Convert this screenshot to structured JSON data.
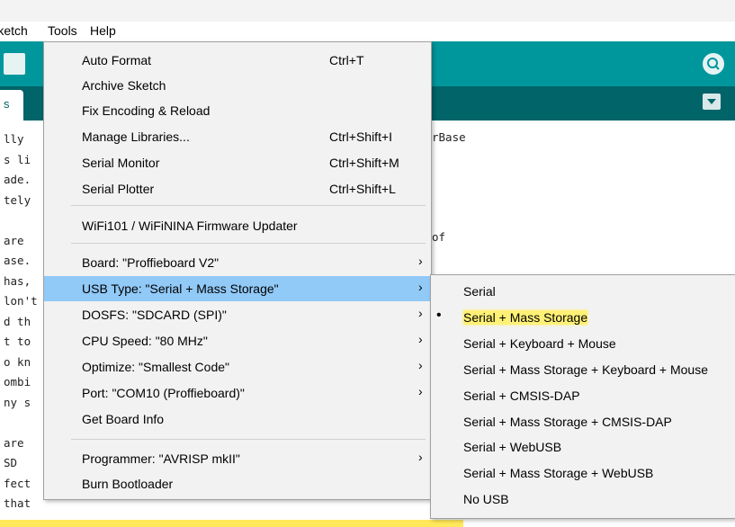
{
  "menubar": {
    "sketch": "Sketch",
    "tools": "Tools",
    "help": "Help"
  },
  "tab": {
    "label": "s"
  },
  "code_left": [
    "lly",
    "s li",
    "ade.",
    "tely",
    "",
    "are",
    "ase.",
    "has,",
    "lon't",
    "d th",
    "t to",
    "o kn",
    "ombi",
    "ny s",
    "",
    "are",
    "SD",
    "fect",
    "that"
  ],
  "code_right": {
    "line1": "rBase",
    "line2": "of"
  },
  "tools_menu": {
    "auto_format": {
      "label": "Auto Format",
      "shortcut": "Ctrl+T"
    },
    "archive_sketch": {
      "label": "Archive Sketch"
    },
    "fix_encoding": {
      "label": "Fix Encoding & Reload"
    },
    "manage_libraries": {
      "label": "Manage Libraries...",
      "shortcut": "Ctrl+Shift+I"
    },
    "serial_monitor": {
      "label": "Serial Monitor",
      "shortcut": "Ctrl+Shift+M"
    },
    "serial_plotter": {
      "label": "Serial Plotter",
      "shortcut": "Ctrl+Shift+L"
    },
    "firmware_updater": {
      "label": "WiFi101 / WiFiNINA Firmware Updater"
    },
    "board": {
      "label": "Board: \"Proffieboard V2\""
    },
    "usb_type": {
      "label": "USB Type: \"Serial + Mass Storage\""
    },
    "dosfs": {
      "label": "DOSFS: \"SDCARD (SPI)\""
    },
    "cpu_speed": {
      "label": "CPU Speed: \"80 MHz\""
    },
    "optimize": {
      "label": "Optimize: \"Smallest Code\""
    },
    "port": {
      "label": "Port: \"COM10 (Proffieboard)\""
    },
    "get_board_info": {
      "label": "Get Board Info"
    },
    "programmer": {
      "label": "Programmer: \"AVRISP mkII\""
    },
    "burn_bootloader": {
      "label": "Burn Bootloader"
    },
    "arrow": "›"
  },
  "usb_submenu": {
    "selected_marker": "•",
    "items": [
      "Serial",
      "Serial + Mass Storage",
      "Serial + Keyboard + Mouse",
      "Serial + Mass Storage + Keyboard + Mouse",
      "Serial + CMSIS-DAP",
      "Serial + Mass Storage + CMSIS-DAP",
      "Serial + WebUSB",
      "Serial + Mass Storage + WebUSB",
      "No USB"
    ]
  },
  "colors": {
    "toolbar": "#00979c",
    "tabs": "#006468",
    "menu_highlight": "#91c9f7",
    "marker_highlight": "#fff176"
  }
}
